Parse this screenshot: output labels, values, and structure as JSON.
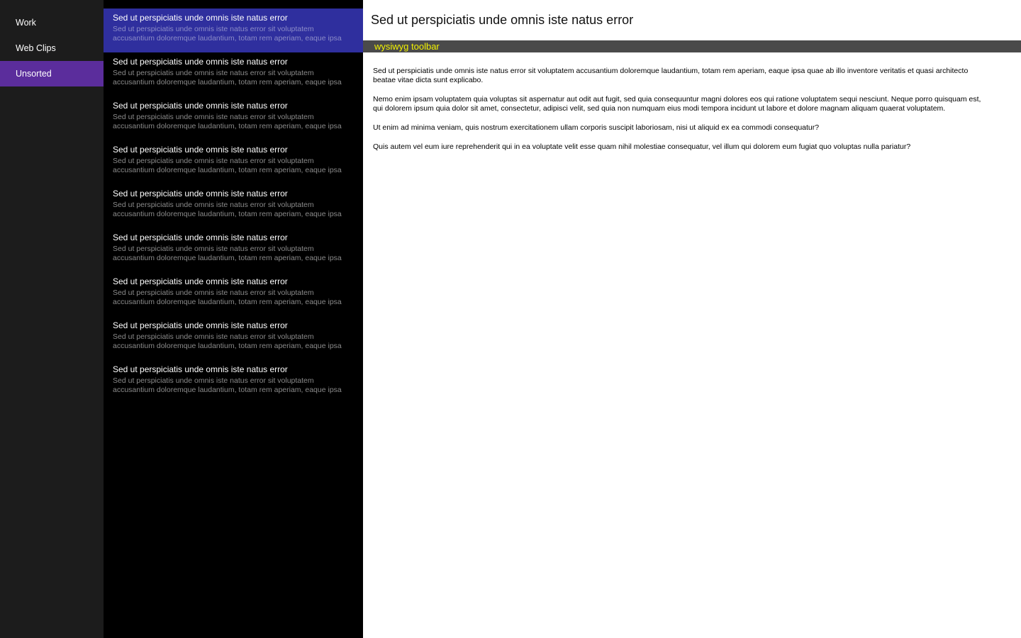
{
  "sidebar": {
    "folders": [
      {
        "label": "Work",
        "selected": false
      },
      {
        "label": "Web Clips",
        "selected": false
      },
      {
        "label": "Unsorted",
        "selected": true
      }
    ]
  },
  "notes": [
    {
      "title": "Sed ut perspiciatis unde omnis iste natus error",
      "preview": "Sed ut perspiciatis unde omnis iste natus error sit voluptatem accusantium doloremque laudantium, totam rem aperiam, eaque ipsa quae ab illo",
      "selected": true
    },
    {
      "title": "Sed ut perspiciatis unde omnis iste natus error",
      "preview": "Sed ut perspiciatis unde omnis iste natus error sit voluptatem accusantium doloremque laudantium, totam rem aperiam, eaque ipsa quae ab illo",
      "selected": false
    },
    {
      "title": "Sed ut perspiciatis unde omnis iste natus error",
      "preview": "Sed ut perspiciatis unde omnis iste natus error sit voluptatem accusantium doloremque laudantium, totam rem aperiam, eaque ipsa quae ab illo",
      "selected": false
    },
    {
      "title": "Sed ut perspiciatis unde omnis iste natus error",
      "preview": "Sed ut perspiciatis unde omnis iste natus error sit voluptatem accusantium doloremque laudantium, totam rem aperiam, eaque ipsa quae ab illo",
      "selected": false
    },
    {
      "title": "Sed ut perspiciatis unde omnis iste natus error",
      "preview": "Sed ut perspiciatis unde omnis iste natus error sit voluptatem accusantium doloremque laudantium, totam rem aperiam, eaque ipsa quae ab illo",
      "selected": false
    },
    {
      "title": "Sed ut perspiciatis unde omnis iste natus error",
      "preview": "Sed ut perspiciatis unde omnis iste natus error sit voluptatem accusantium doloremque laudantium, totam rem aperiam, eaque ipsa quae ab illo",
      "selected": false
    },
    {
      "title": "Sed ut perspiciatis unde omnis iste natus error",
      "preview": "Sed ut perspiciatis unde omnis iste natus error sit voluptatem accusantium doloremque laudantium, totam rem aperiam, eaque ipsa quae ab illo",
      "selected": false
    },
    {
      "title": "Sed ut perspiciatis unde omnis iste natus error",
      "preview": "Sed ut perspiciatis unde omnis iste natus error sit voluptatem accusantium doloremque laudantium, totam rem aperiam, eaque ipsa quae ab illo",
      "selected": false
    },
    {
      "title": "Sed ut perspiciatis unde omnis iste natus error",
      "preview": "Sed ut perspiciatis unde omnis iste natus error sit voluptatem accusantium doloremque laudantium, totam rem aperiam, eaque ipsa quae ab illo",
      "selected": false
    }
  ],
  "editor": {
    "title": "Sed ut perspiciatis unde omnis iste natus error",
    "toolbar_label": "wysiwyg toolbar",
    "paragraphs": [
      "Sed ut perspiciatis unde omnis iste natus error sit voluptatem accusantium doloremque laudantium, totam rem aperiam, eaque ipsa quae ab illo inventore veritatis et quasi architecto beatae vitae dicta sunt explicabo.",
      "Nemo enim ipsam voluptatem quia voluptas sit aspernatur aut odit aut fugit, sed quia consequuntur magni dolores eos qui ratione voluptatem sequi nesciunt. Neque porro quisquam est, qui dolorem ipsum quia dolor sit amet, consectetur, adipisci velit, sed quia non numquam eius modi tempora incidunt ut labore et dolore magnam aliquam quaerat voluptatem.",
      "Ut enim ad minima veniam, quis nostrum exercitationem ullam corporis suscipit laboriosam, nisi ut aliquid ex ea commodi consequatur?",
      "Quis autem vel eum iure reprehenderit qui in ea voluptate velit esse quam  nihil molestiae consequatur, vel illum qui dolorem eum fugiat quo voluptas nulla pariatur?"
    ]
  },
  "colors": {
    "sidebar_bg": "#1c1c1c",
    "folder_selected": "#5b2d9c",
    "list_bg": "#000000",
    "note_selected": "#2f2f9e",
    "toolbar_bg": "#4a4a4a",
    "toolbar_text": "#f2f200"
  }
}
